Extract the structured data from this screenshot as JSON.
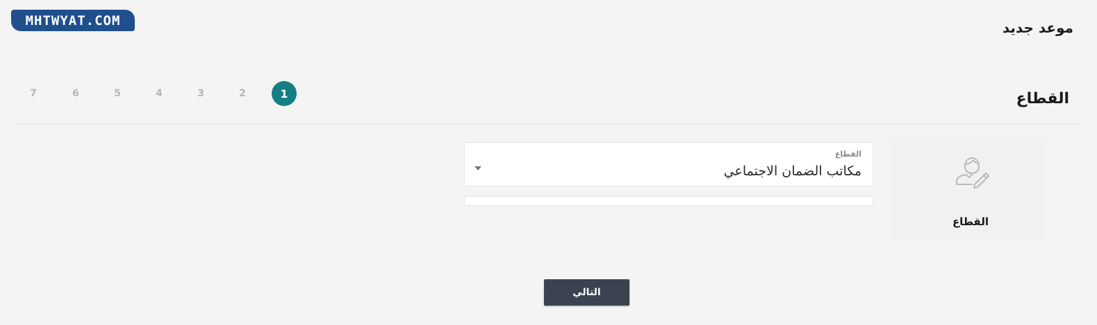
{
  "logo": {
    "text": "MHTWYAT.COM"
  },
  "header": {
    "title": "موعد جديد"
  },
  "section": {
    "title": "القطاع"
  },
  "steps": [
    {
      "label": "1",
      "active": true
    },
    {
      "label": "2",
      "active": false
    },
    {
      "label": "3",
      "active": false
    },
    {
      "label": "4",
      "active": false
    },
    {
      "label": "5",
      "active": false
    },
    {
      "label": "6",
      "active": false
    },
    {
      "label": "7",
      "active": false
    }
  ],
  "sidebar_card": {
    "icon": "user-edit-icon",
    "label": "القطاع"
  },
  "sector_select": {
    "label": "القطاع",
    "value": "مكاتب الضمان الاجتماعي"
  },
  "actions": {
    "next_label": "التالي"
  },
  "colors": {
    "accent": "#137f84",
    "button": "#3b4250",
    "logo": "#1f4f8c",
    "background": "#f4f4f4"
  }
}
